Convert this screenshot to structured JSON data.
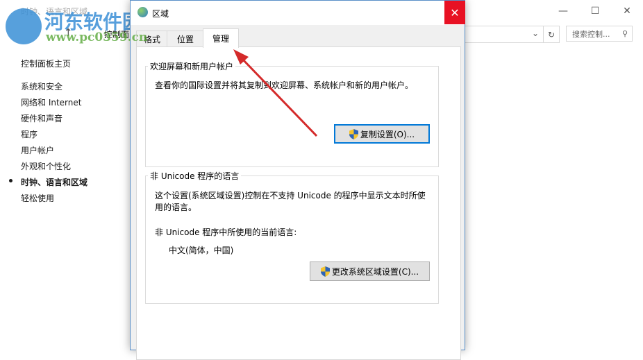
{
  "background_window": {
    "title": "时钟、语言和区域",
    "address": "控制面",
    "search_placeholder": "搜索控制...",
    "sidebar": [
      {
        "label": "控制面板主页"
      },
      {
        "label": "系统和安全"
      },
      {
        "label": "网络和 Internet"
      },
      {
        "label": "硬件和声音"
      },
      {
        "label": "程序"
      },
      {
        "label": "用户帐户"
      },
      {
        "label": "外观和个性化"
      },
      {
        "label": "时钟、语言和区域",
        "active": true
      },
      {
        "label": "轻松使用"
      }
    ]
  },
  "dialog": {
    "title": "区域",
    "tabs": [
      {
        "label": "格式"
      },
      {
        "label": "位置"
      },
      {
        "label": "管理",
        "selected": true
      }
    ],
    "welcome_group": {
      "label": "欢迎屏幕和新用户帐户",
      "description": "查看你的国际设置并将其复制到欢迎屏幕、系统帐户和新的用户帐户。",
      "button": "复制设置(O)..."
    },
    "unicode_group": {
      "label": "非 Unicode 程序的语言",
      "description_line1": "这个设置(系统区域设置)控制在不支持 Unicode 的程序中显示文本时所使",
      "description_line2": "用的语言。",
      "current_label": "非 Unicode 程序中所使用的当前语言:",
      "current_value": "中文(简体，中国)",
      "button": "更改系统区域设置(C)..."
    }
  },
  "watermark": {
    "logo": "河东软件园",
    "url": "www.pc0359.cn"
  },
  "colors": {
    "close": "#e81123",
    "accent": "#0078d7",
    "arrow": "#d42a2a"
  }
}
